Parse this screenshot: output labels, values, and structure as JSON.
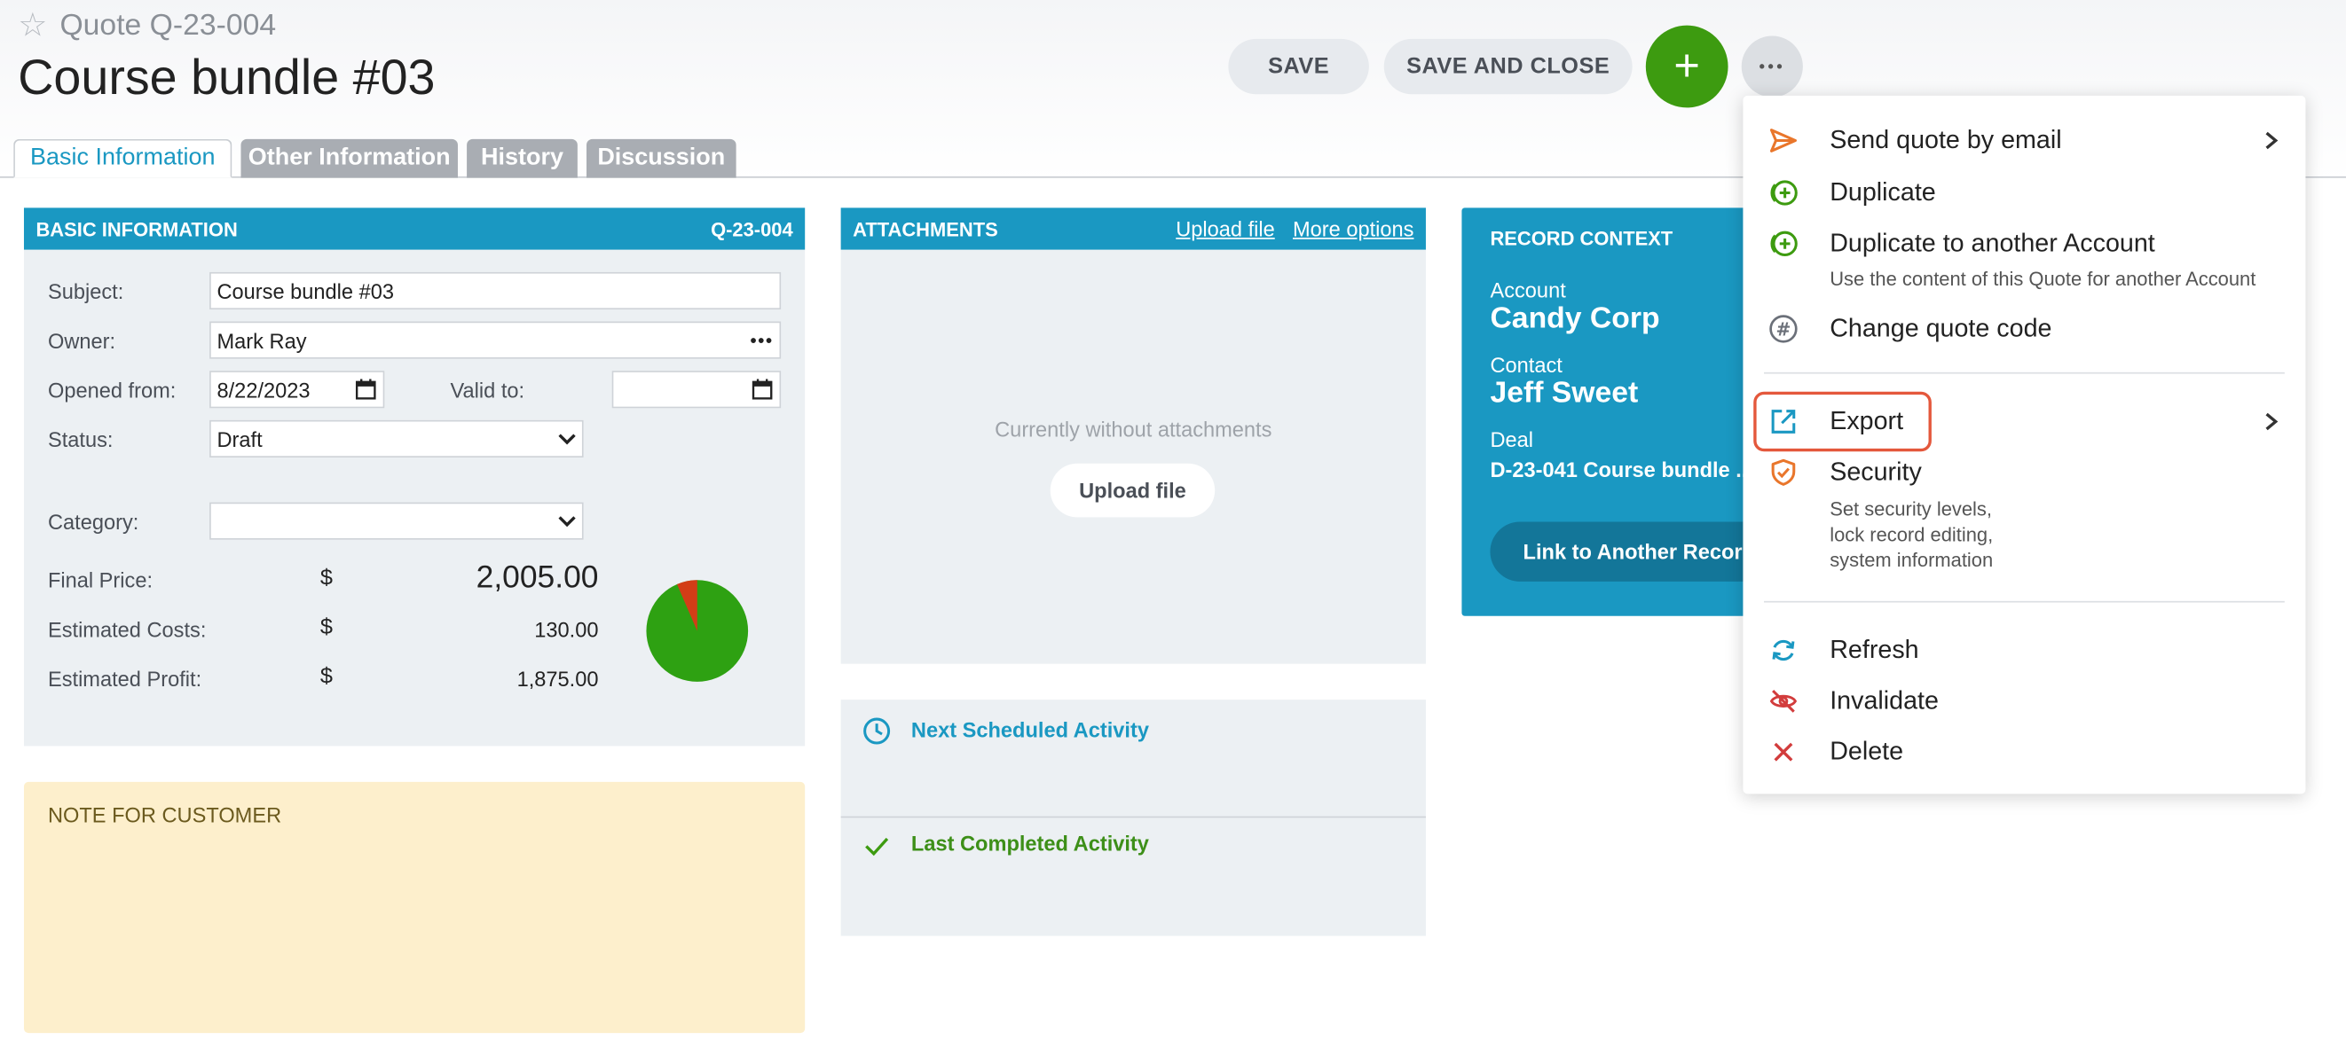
{
  "header": {
    "quote_label": "Quote Q-23-004",
    "title": "Course bundle #03",
    "save_label": "SAVE",
    "save_close_label": "SAVE AND CLOSE",
    "add_label": "+",
    "more_label": "•••"
  },
  "tabs": [
    "Basic Information",
    "Other Information",
    "History",
    "Discussion"
  ],
  "basic_info": {
    "title": "BASIC INFORMATION",
    "code": "Q-23-004",
    "subject_label": "Subject:",
    "subject_value": "Course bundle #03",
    "owner_label": "Owner:",
    "owner_value": "Mark Ray",
    "opened_label": "Opened from:",
    "opened_value": "8/22/2023",
    "valid_label": "Valid to:",
    "valid_value": "",
    "status_label": "Status:",
    "status_value": "Draft",
    "category_label": "Category:",
    "category_value": "",
    "currency": "$",
    "final_price_label": "Final Price:",
    "final_price": "2,005.00",
    "est_costs_label": "Estimated Costs:",
    "est_costs": "130.00",
    "est_profit_label": "Estimated Profit:",
    "est_profit": "1,875.00",
    "profit_chart": {
      "costs_fraction": 0.065,
      "costs_color": "#d33d17",
      "profit_color": "#2ea112"
    }
  },
  "note": {
    "label": "NOTE FOR CUSTOMER"
  },
  "attachments": {
    "title": "ATTACHMENTS",
    "upload_link": "Upload file",
    "more_options_link": "More options",
    "empty_text": "Currently without attachments",
    "upload_button": "Upload file"
  },
  "activities": {
    "next_label": "Next Scheduled Activity",
    "last_label": "Last Completed Activity"
  },
  "record_context": {
    "title": "RECORD CONTEXT",
    "account_label": "Account",
    "account_value": "Candy Corp",
    "contact_label": "Contact",
    "contact_value": "Jeff Sweet",
    "deal_label": "Deal",
    "deal_value": "D-23-041 Course bundle ...",
    "link_button": "Link to Another Record"
  },
  "menu": {
    "send_email": "Send quote by email",
    "duplicate": "Duplicate",
    "duplicate_account": "Duplicate to another Account",
    "duplicate_account_sub": "Use the content of this Quote for another Account",
    "change_code": "Change quote code",
    "export": "Export",
    "security": "Security",
    "security_sub_1": "Set security levels,",
    "security_sub_2": "lock record editing,",
    "security_sub_3": "system information",
    "refresh": "Refresh",
    "invalidate": "Invalidate",
    "delete": "Delete"
  },
  "colors": {
    "accent": "#1a98c2",
    "add_button": "#3d9b10",
    "highlight": "#e4583c"
  }
}
